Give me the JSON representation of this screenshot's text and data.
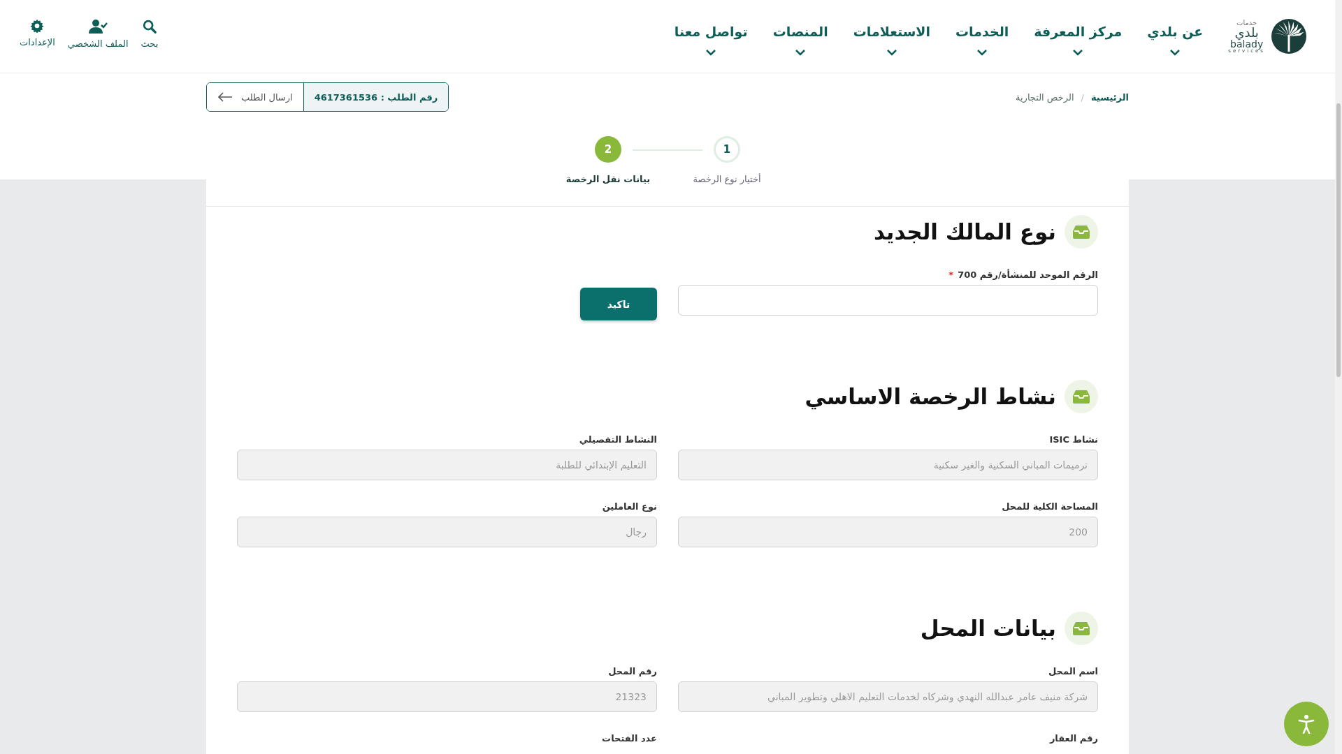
{
  "header": {
    "logo": {
      "top": "خدمات",
      "main": "بلدي",
      "latin": "balady",
      "sub": "services"
    },
    "nav": [
      {
        "label": "عن بلدي"
      },
      {
        "label": "مركز المعرفة"
      },
      {
        "label": "الخدمات"
      },
      {
        "label": "الاستعلامات"
      },
      {
        "label": "المنصات"
      },
      {
        "label": "تواصل معنا"
      }
    ],
    "tools": [
      {
        "kind": "search",
        "label": "بحث"
      },
      {
        "kind": "profile",
        "label": "الملف الشخصي"
      },
      {
        "kind": "settings",
        "label": "الإعدادات"
      }
    ]
  },
  "breadcrumb": [
    {
      "label": "الرئيسية",
      "current": false
    },
    {
      "separator": "/",
      "label": "الرخص التجارية",
      "current": true
    }
  ],
  "request": {
    "number": "رقم الطلب : 4617361536",
    "send": "ارسال الطلب"
  },
  "steps": [
    {
      "number": "1",
      "label": "أختيار نوع الرخصة",
      "selected": false
    },
    {
      "number": "2",
      "label": "بيانات نقل الرخصة",
      "selected": true
    }
  ],
  "sections": [
    {
      "title": "نوع المالك الجديد",
      "button": "تاكيد",
      "fields": [
        {
          "kind": "field",
          "label": "الرقم الموحد للمنشأة/رقم 700",
          "required_mark": "*",
          "disabled": false
        }
      ]
    },
    {
      "title": "نشاط الرخصة الاساسي",
      "fields": [
        {
          "kind": "field",
          "label": "نشاط ISIC",
          "disabled": true,
          "value": "ترميمات المباني السكنية والغير سكنية"
        },
        {
          "kind": "field",
          "label": "النشاط التفصيلي",
          "disabled": true,
          "value": "التعليم الإبتدائي للطلبة"
        },
        {
          "kind": "field",
          "label": "المساحة الكلية للمحل",
          "disabled": true,
          "value": "200"
        },
        {
          "kind": "field",
          "label": "نوع العاملين",
          "disabled": true,
          "value": "رجال"
        }
      ]
    },
    {
      "title": "بيانات المحل",
      "fields": [
        {
          "kind": "field",
          "label": "اسم المحل",
          "disabled": true,
          "value": "شركة منيف عامر عبدالله النهدي وشركاه لخدمات التعليم الاهلي وتطوير المباني"
        },
        {
          "kind": "field",
          "label": "رقم المحل",
          "disabled": true,
          "value": "21323"
        },
        {
          "kind": "label",
          "label": "رقم العقار"
        },
        {
          "kind": "label",
          "label": "عدد الفتحات"
        }
      ]
    }
  ]
}
